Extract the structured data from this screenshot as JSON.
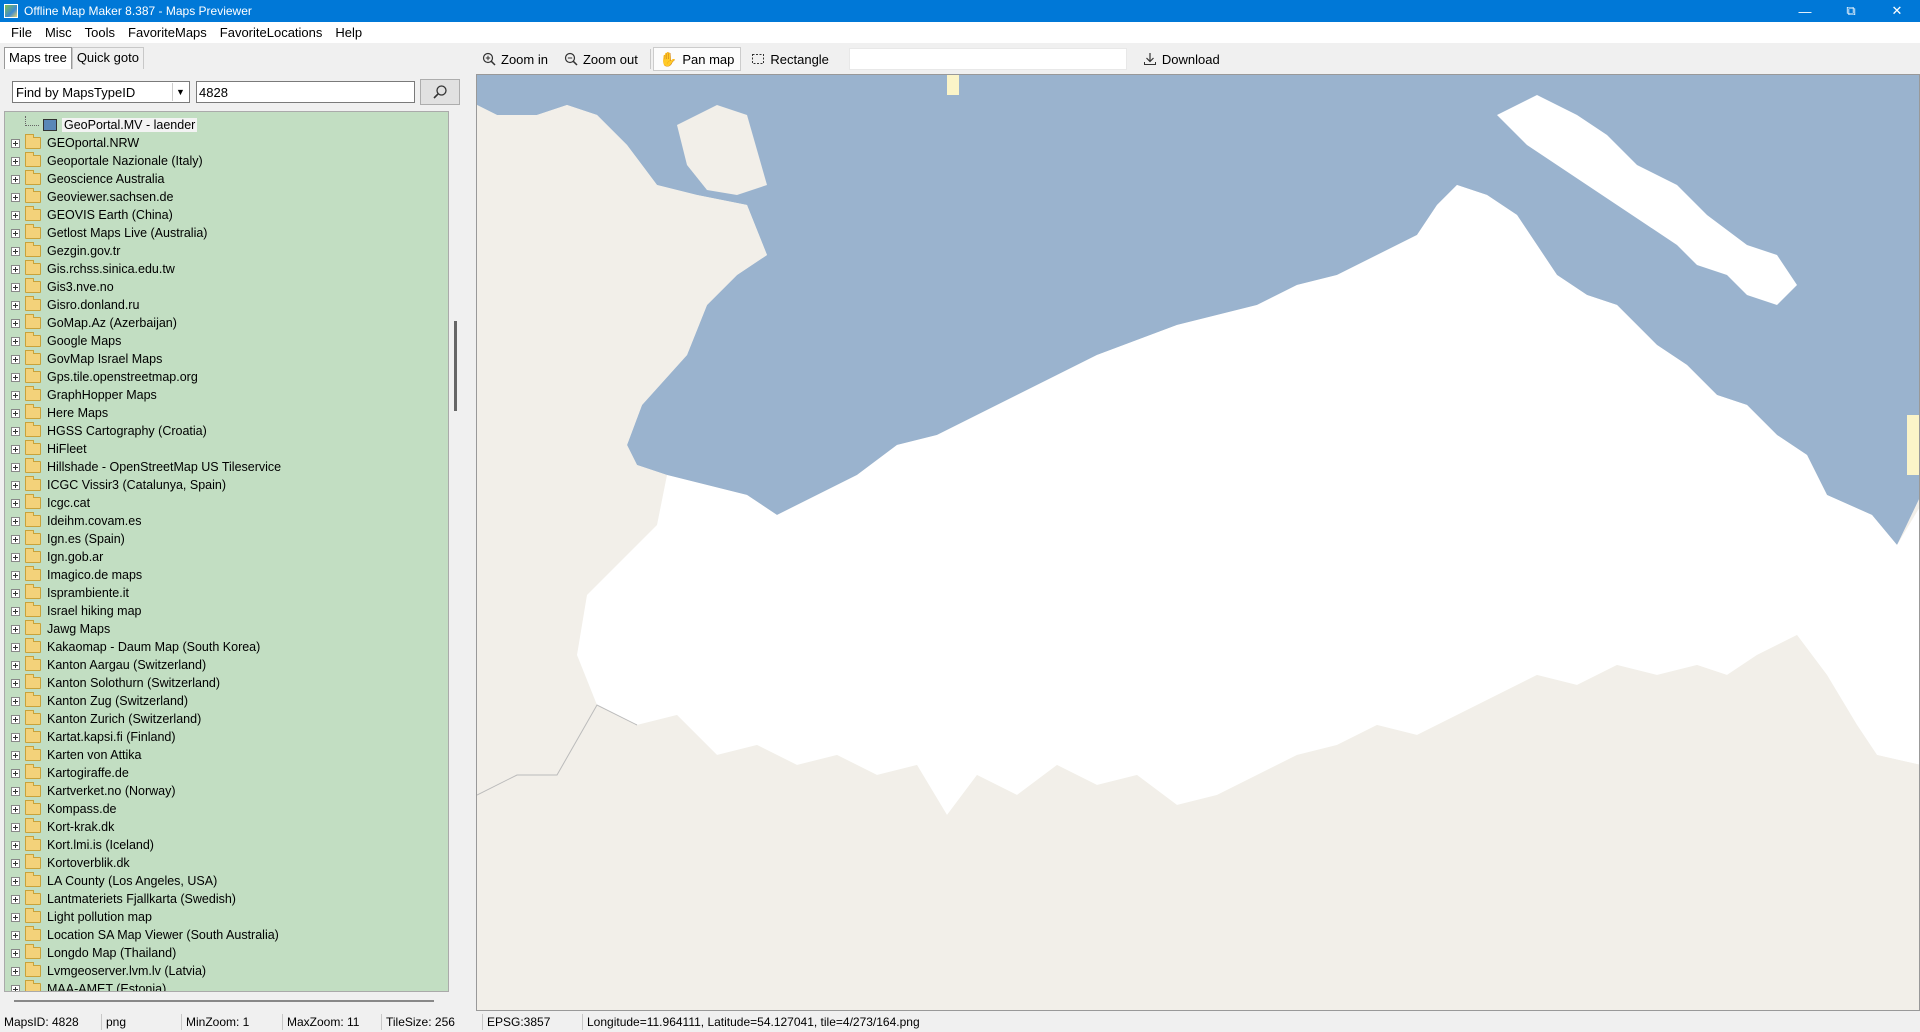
{
  "window": {
    "title": "Offline Map Maker 8.387 - Maps Previewer"
  },
  "menu": [
    "File",
    "Misc",
    "Tools",
    "FavoriteMaps",
    "FavoriteLocations",
    "Help"
  ],
  "tabs": [
    "Maps tree",
    "Quick goto"
  ],
  "search": {
    "mode": "Find by MapsTypeID",
    "value": "4828"
  },
  "tree": {
    "selected_node": "GeoPortal.MV - laender",
    "items": [
      "GEOportal.NRW",
      "Geoportale Nazionale (Italy)",
      "Geoscience Australia",
      "Geoviewer.sachsen.de",
      "GEOVIS Earth (China)",
      "Getlost Maps Live (Australia)",
      "Gezgin.gov.tr",
      "Gis.rchss.sinica.edu.tw",
      "Gis3.nve.no",
      "Gisro.donland.ru",
      "GoMap.Az (Azerbaijan)",
      "Google Maps",
      "GovMap Israel Maps",
      "Gps.tile.openstreetmap.org",
      "GraphHopper Maps",
      "Here Maps",
      "HGSS Cartography (Croatia)",
      "HiFleet",
      "Hillshade - OpenStreetMap US Tileservice",
      "ICGC Vissir3 (Catalunya, Spain)",
      "Icgc.cat",
      "Ideihm.covam.es",
      "Ign.es (Spain)",
      "Ign.gob.ar",
      "Imagico.de maps",
      "Isprambiente.it",
      "Israel hiking map",
      "Jawg Maps",
      "Kakaomap - Daum Map (South Korea)",
      "Kanton Aargau (Switzerland)",
      "Kanton Solothurn (Switzerland)",
      "Kanton Zug (Switzerland)",
      "Kanton Zurich (Switzerland)",
      "Kartat.kapsi.fi (Finland)",
      "Karten von Attika",
      "Kartogiraffe.de",
      "Kartverket.no (Norway)",
      "Kompass.de",
      "Kort-krak.dk",
      "Kort.lmi.is (Iceland)",
      "Kortoverblik.dk",
      "LA County (Los Angeles, USA)",
      "Lantmateriets Fjallkarta (Swedish)",
      "Light pollution map",
      "Location SA Map Viewer (South Australia)",
      "Longdo Map (Thailand)",
      "Lvmgeoserver.lvm.lv (Latvia)",
      "MAA-AMET (Estonia)"
    ]
  },
  "toolbar": {
    "zoom_in": "Zoom in",
    "zoom_out": "Zoom out",
    "pan_map": "Pan map",
    "rectangle": "Rectangle",
    "download": "Download"
  },
  "colors": {
    "water": "#9ab3ce",
    "land_other": "#f2efe9",
    "land_region": "#ffffff",
    "tree_bg": "#c2dec2",
    "titlebar": "#0078d7",
    "yellow_area": "#fbf4c8"
  },
  "status": {
    "maps_id": "MapsID: 4828",
    "format": "png",
    "min_zoom": "MinZoom: 1",
    "max_zoom": "MaxZoom: 11",
    "tile_size": "TileSize: 256",
    "epsg": "EPSG:3857",
    "coords": "Longitude=11.964111, Latitude=54.127041, tile=4/273/164.png"
  }
}
